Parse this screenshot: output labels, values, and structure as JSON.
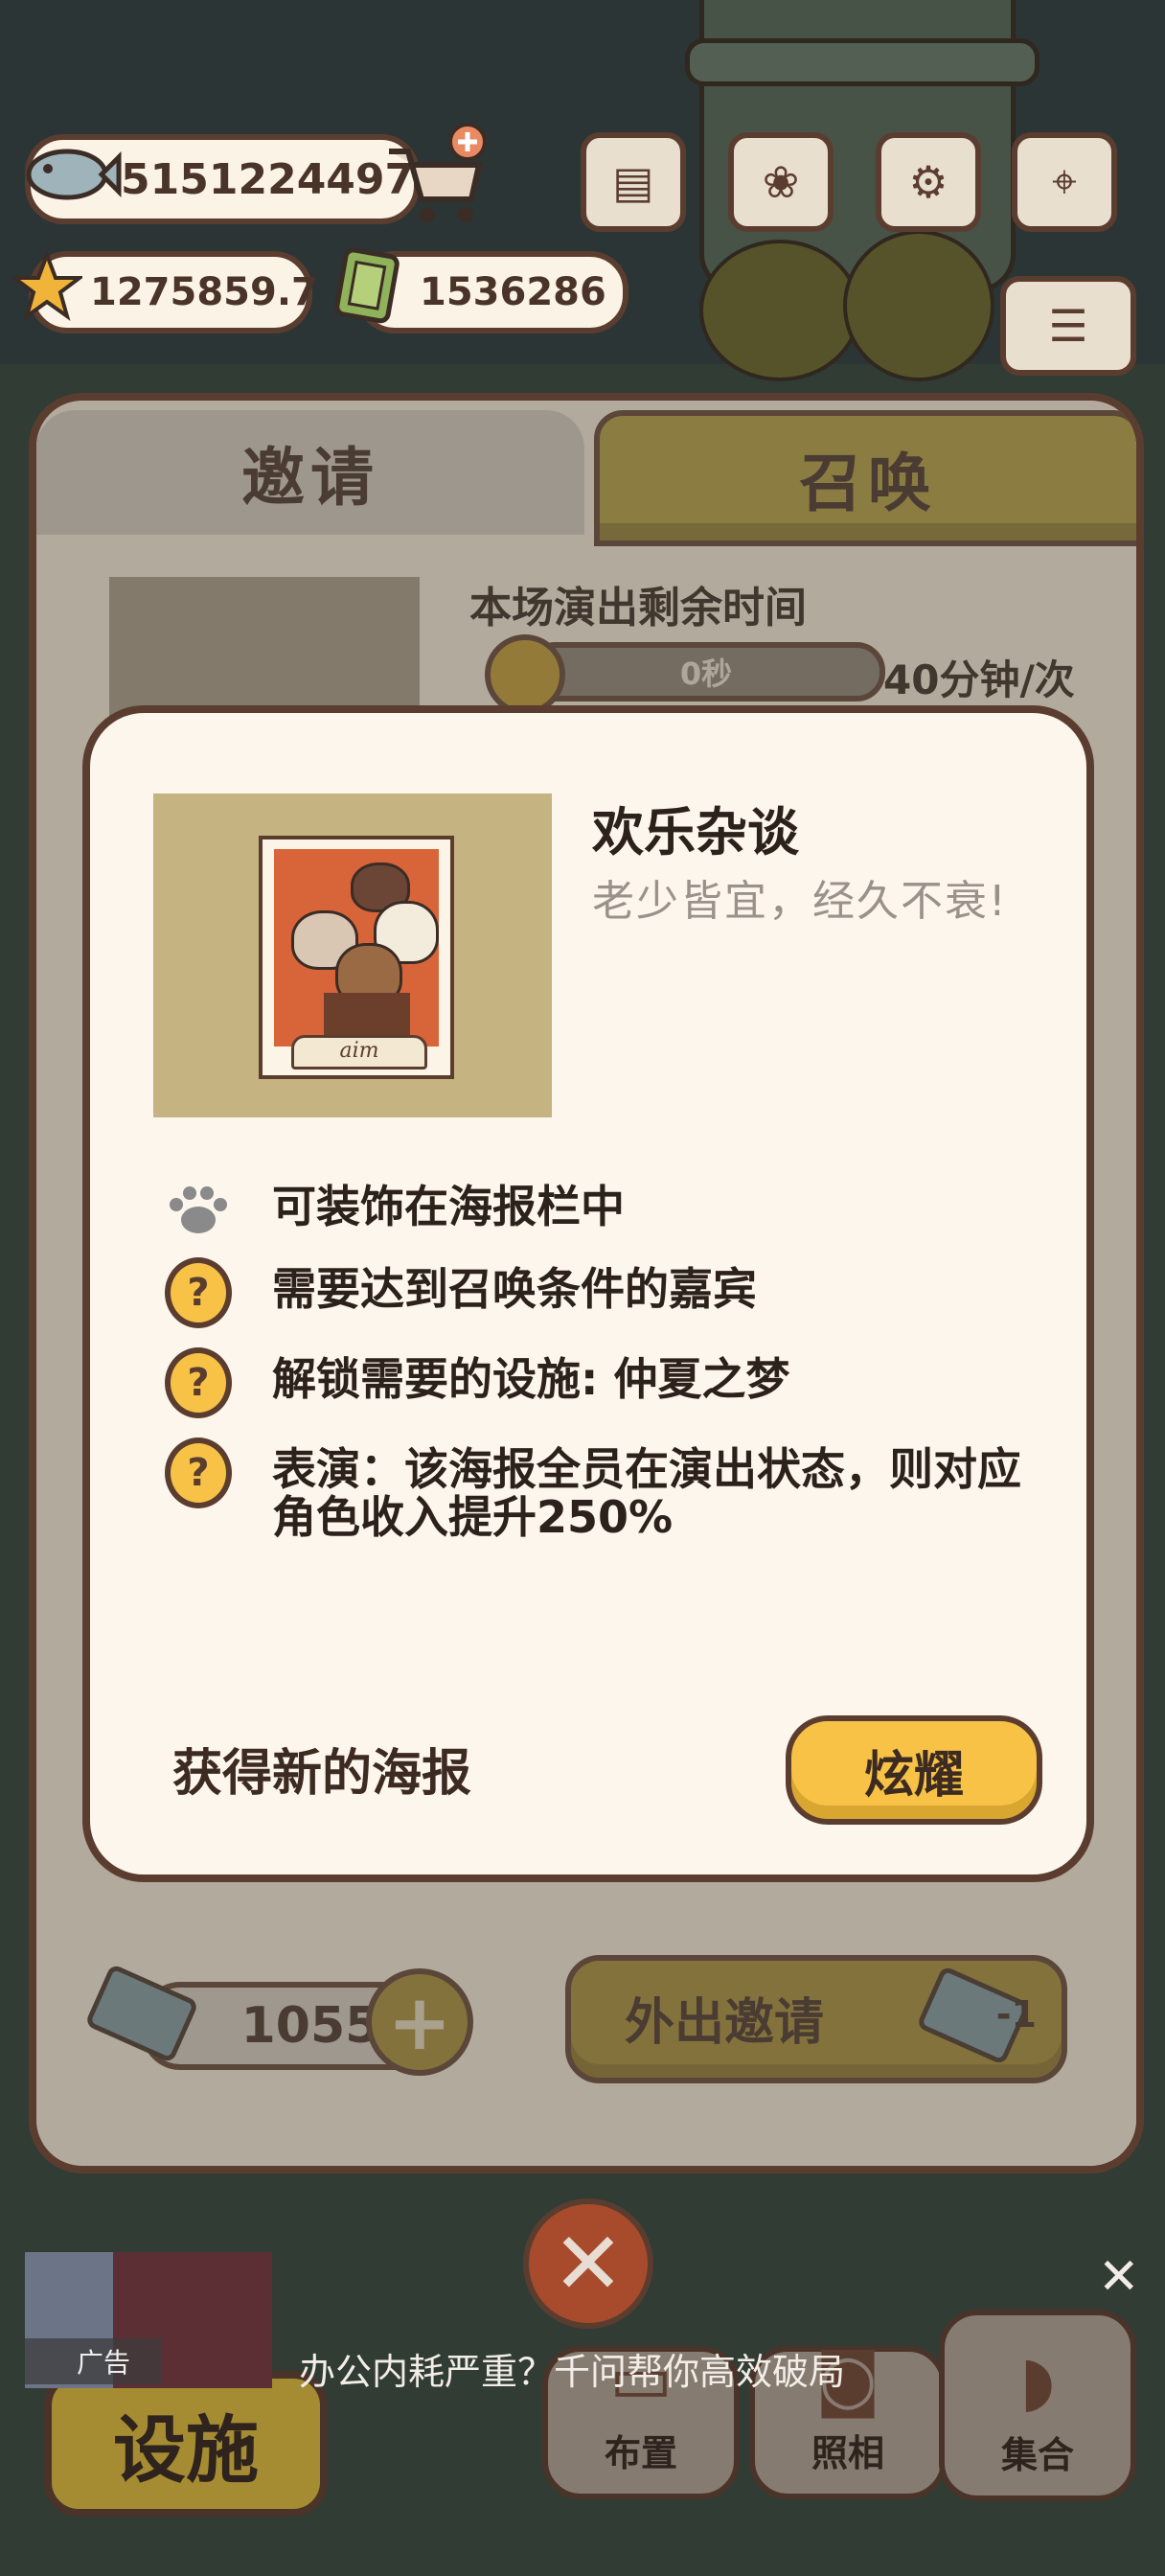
{
  "hud": {
    "fish_count": "5151224497",
    "star_count": "1275859.7",
    "cash_count": "1536286"
  },
  "tabs": {
    "invite": "邀请",
    "summon": "召唤"
  },
  "show": {
    "remaining_label": "本场演出剩余时间",
    "timer_value": "0秒",
    "rate": "40分钟/次"
  },
  "modal": {
    "title": "欢乐杂谈",
    "subtitle": "老少皆宜，经久不衰!",
    "poster_sign": "aim",
    "requirements": [
      {
        "icon": "paw-icon",
        "text": "可装饰在海报栏中"
      },
      {
        "icon": "question-icon",
        "text": "需要达到召唤条件的嘉宾"
      },
      {
        "icon": "question-icon",
        "text": "解锁需要的设施: 仲夏之梦"
      },
      {
        "icon": "question-icon",
        "text": "表演：该海报全员在演出状态，则对应角色收入提升250%"
      }
    ],
    "question_mark": "?",
    "got_new_poster": "获得新的海报",
    "show_off_button": "炫耀"
  },
  "footer": {
    "ticket_count": "1055",
    "go_invite_label": "外出邀请",
    "go_invite_cost": "-1"
  },
  "bottom_nav": {
    "facility": "设施",
    "layout": "布置",
    "photo": "照相",
    "gather": "集合"
  },
  "ad": {
    "tag": "广告",
    "text": "办公内耗严重？千问帮你高效破局"
  },
  "colors": {
    "border_brown": "#5b3d30",
    "gold": "#f7c246",
    "cream": "#fcf6ec"
  }
}
